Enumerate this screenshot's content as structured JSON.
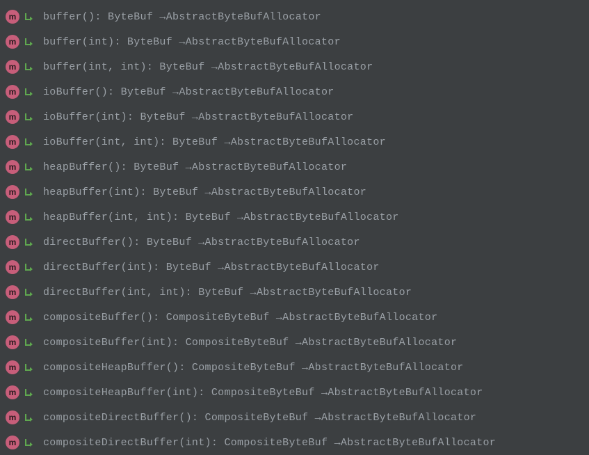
{
  "methods": [
    {
      "signature": "buffer(): ByteBuf →AbstractByteBufAllocator"
    },
    {
      "signature": "buffer(int): ByteBuf →AbstractByteBufAllocator"
    },
    {
      "signature": "buffer(int, int): ByteBuf →AbstractByteBufAllocator"
    },
    {
      "signature": "ioBuffer(): ByteBuf →AbstractByteBufAllocator"
    },
    {
      "signature": "ioBuffer(int): ByteBuf →AbstractByteBufAllocator"
    },
    {
      "signature": "ioBuffer(int, int): ByteBuf →AbstractByteBufAllocator"
    },
    {
      "signature": "heapBuffer(): ByteBuf →AbstractByteBufAllocator"
    },
    {
      "signature": "heapBuffer(int): ByteBuf →AbstractByteBufAllocator"
    },
    {
      "signature": "heapBuffer(int, int): ByteBuf →AbstractByteBufAllocator"
    },
    {
      "signature": "directBuffer(): ByteBuf →AbstractByteBufAllocator"
    },
    {
      "signature": "directBuffer(int): ByteBuf →AbstractByteBufAllocator"
    },
    {
      "signature": "directBuffer(int, int): ByteBuf →AbstractByteBufAllocator"
    },
    {
      "signature": "compositeBuffer(): CompositeByteBuf →AbstractByteBufAllocator"
    },
    {
      "signature": "compositeBuffer(int): CompositeByteBuf →AbstractByteBufAllocator"
    },
    {
      "signature": "compositeHeapBuffer(): CompositeByteBuf →AbstractByteBufAllocator"
    },
    {
      "signature": "compositeHeapBuffer(int): CompositeByteBuf →AbstractByteBufAllocator"
    },
    {
      "signature": "compositeDirectBuffer(): CompositeByteBuf →AbstractByteBufAllocator"
    },
    {
      "signature": "compositeDirectBuffer(int): CompositeByteBuf →AbstractByteBufAllocator"
    }
  ],
  "icons": {
    "methodLetter": "m"
  }
}
